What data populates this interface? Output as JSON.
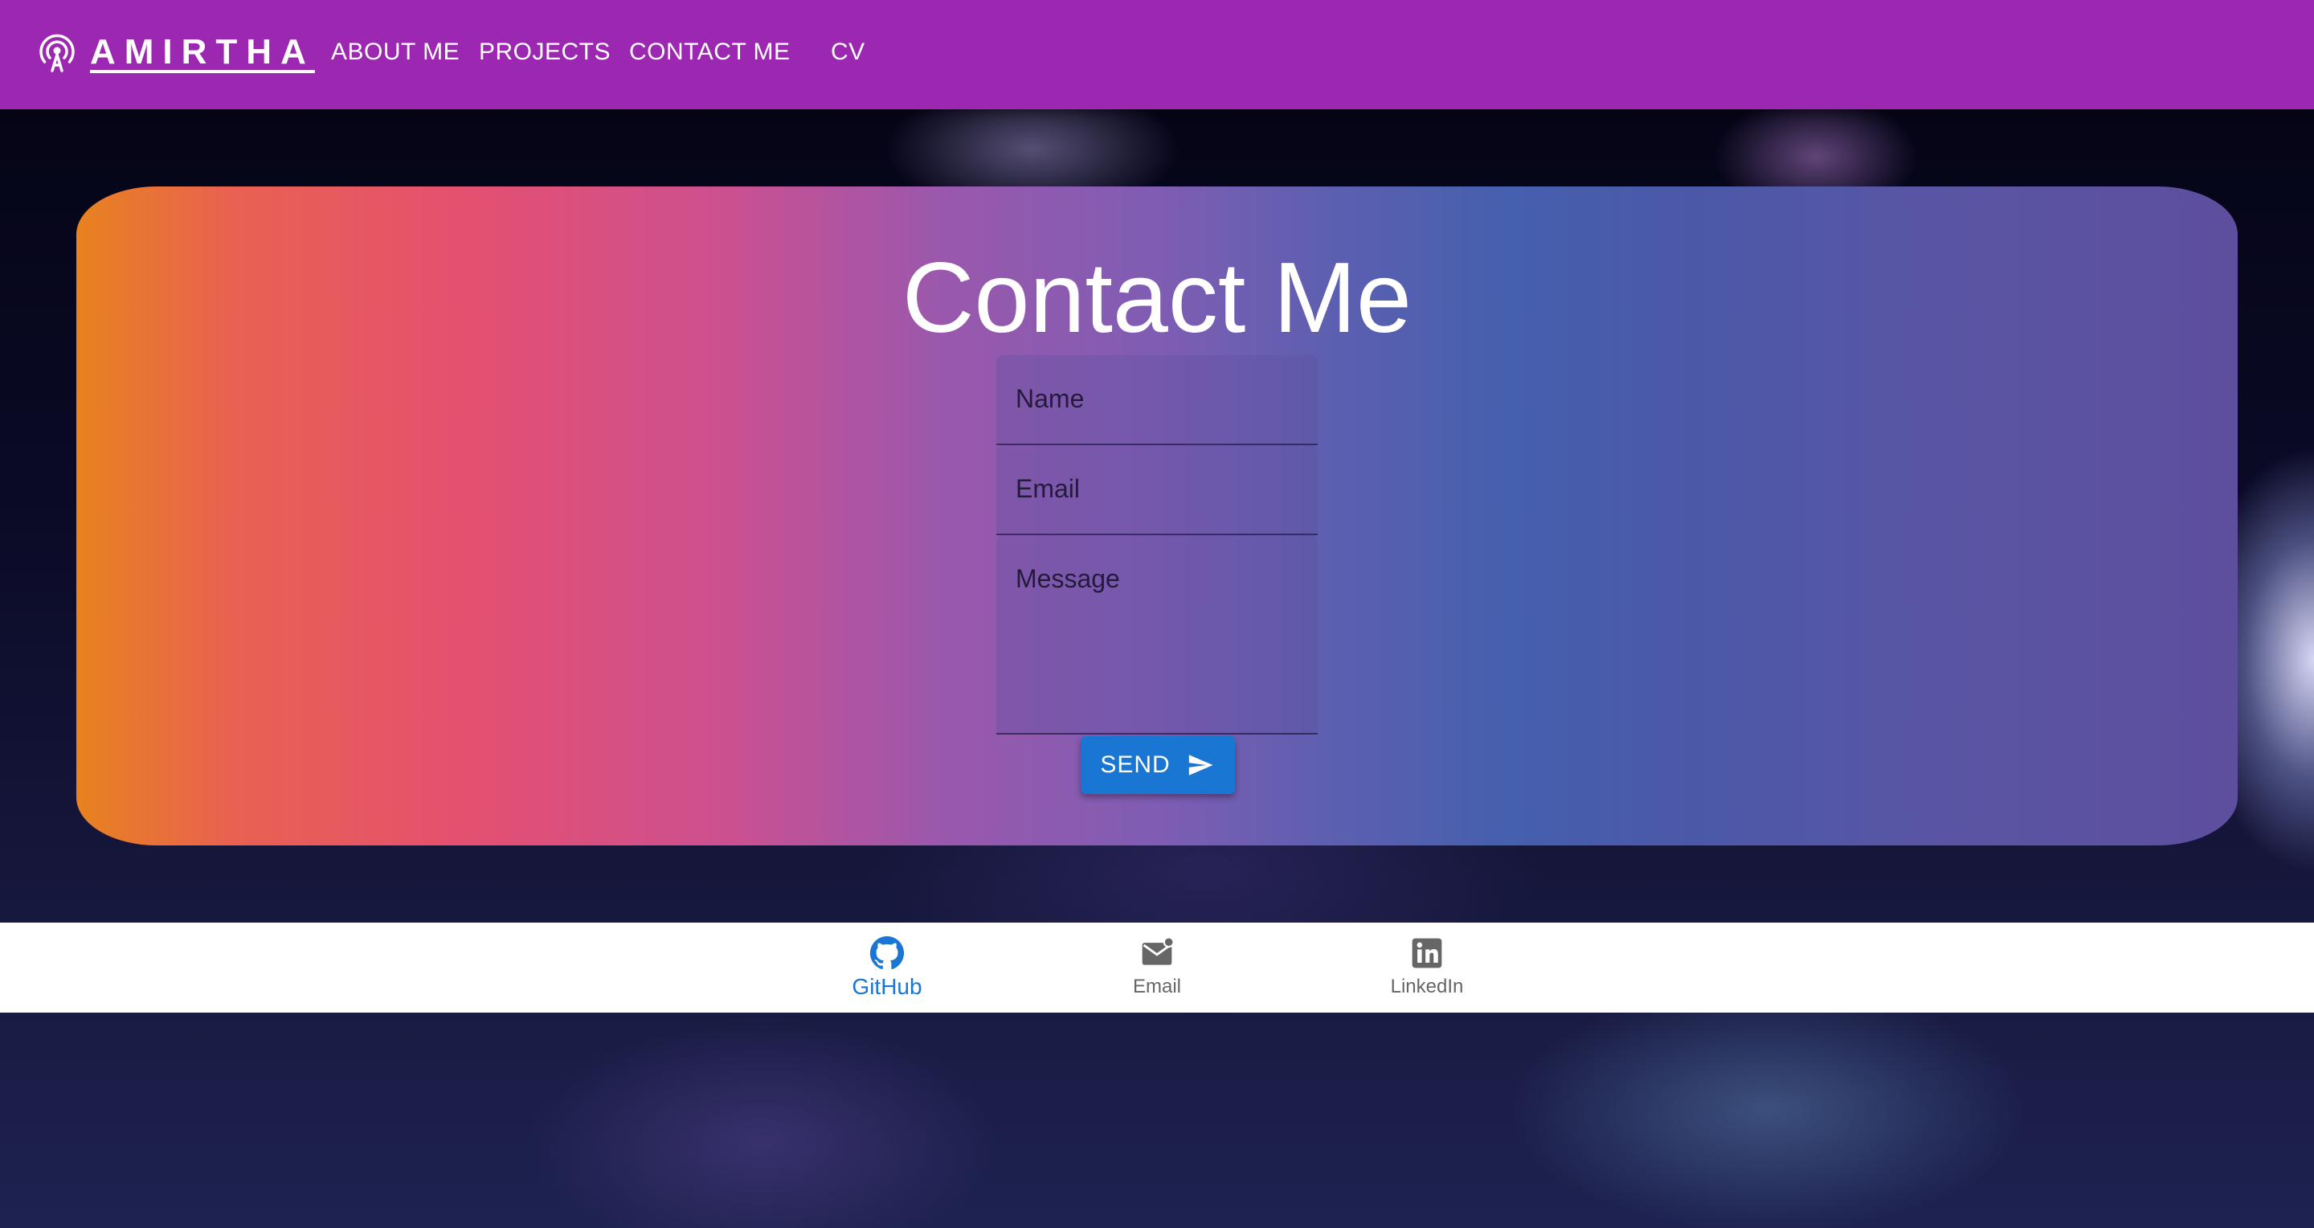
{
  "navbar": {
    "brand": "AMIRTHA",
    "links": [
      "ABOUT ME",
      "PROJECTS",
      "CONTACT ME",
      "CV"
    ],
    "background_color": "#9c27b0"
  },
  "contact": {
    "title": "Contact Me",
    "name_placeholder": "Name",
    "email_placeholder": "Email",
    "message_placeholder": "Message",
    "send_label": "SEND",
    "send_color": "#1976d2"
  },
  "bottom_nav": {
    "items": [
      {
        "label": "GitHub",
        "icon": "github-icon",
        "active": true
      },
      {
        "label": "Email",
        "icon": "mail-icon",
        "active": false
      },
      {
        "label": "LinkedIn",
        "icon": "linkedin-icon",
        "active": false
      }
    ]
  }
}
